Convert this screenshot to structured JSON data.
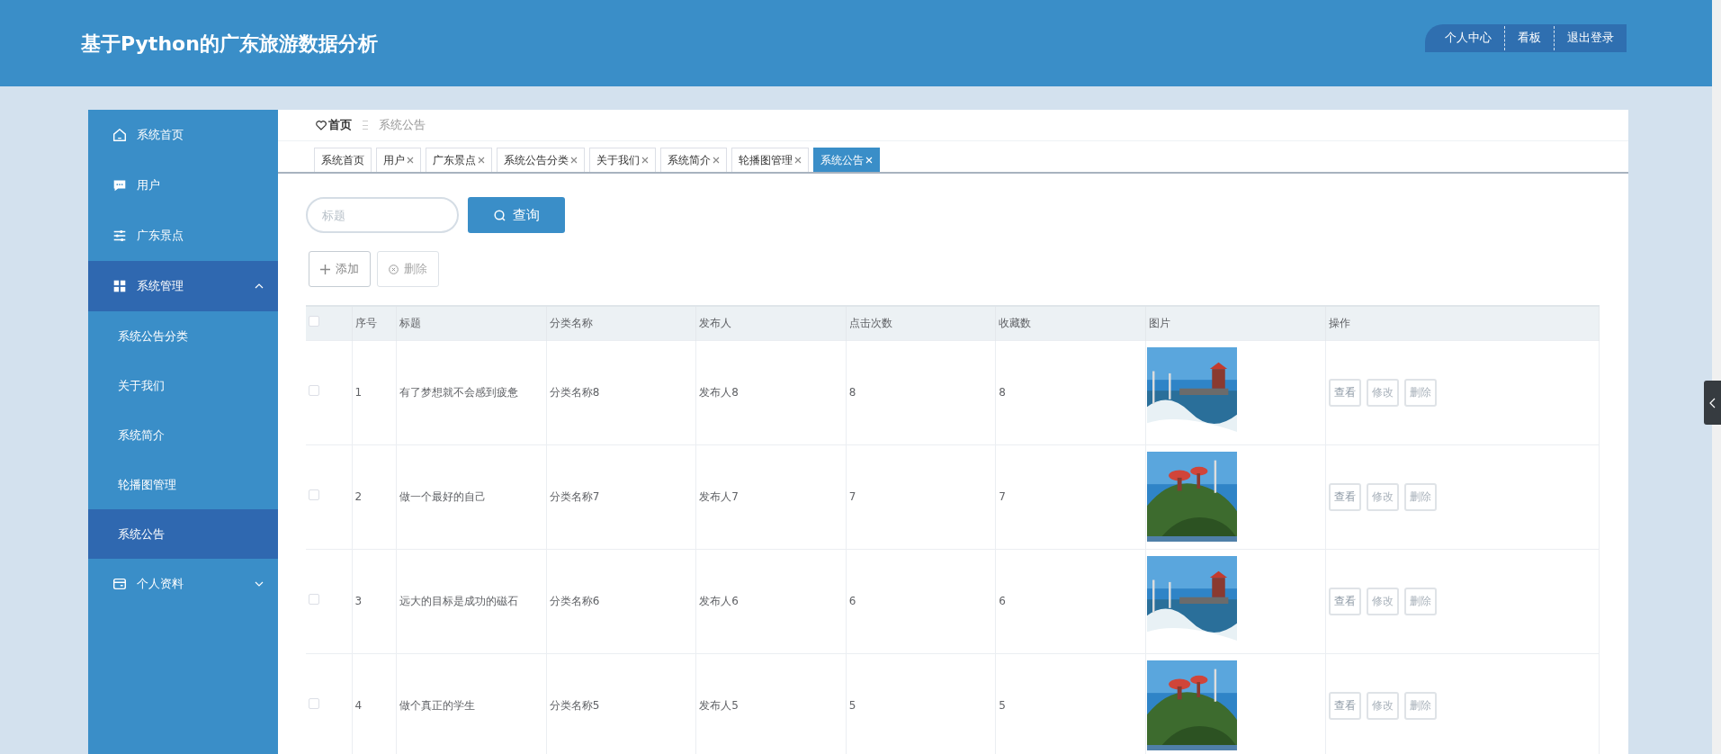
{
  "header": {
    "title": "基于Python的广东旅游数据分析",
    "menu": [
      "个人中心",
      "看板",
      "退出登录"
    ]
  },
  "sidebar": {
    "items": [
      {
        "label": "系统首页",
        "selected": false
      },
      {
        "label": "用户",
        "selected": false
      },
      {
        "label": "广东景点",
        "selected": false
      },
      {
        "label": "系统管理",
        "selected": false,
        "expanded": true,
        "children": [
          {
            "label": "系统公告分类",
            "selected": false
          },
          {
            "label": "关于我们",
            "selected": false
          },
          {
            "label": "系统简介",
            "selected": false
          },
          {
            "label": "轮播图管理",
            "selected": false
          },
          {
            "label": "系统公告",
            "selected": true
          }
        ]
      },
      {
        "label": "个人资料",
        "selected": false,
        "expanded": false
      }
    ]
  },
  "breadcrumb": [
    "首页",
    "系统公告"
  ],
  "tabs": [
    {
      "label": "系统首页",
      "closable": false,
      "selected": false
    },
    {
      "label": "用户",
      "closable": true,
      "selected": false
    },
    {
      "label": "广东景点",
      "closable": true,
      "selected": false
    },
    {
      "label": "系统公告分类",
      "closable": true,
      "selected": false
    },
    {
      "label": "关于我们",
      "closable": true,
      "selected": false
    },
    {
      "label": "系统简介",
      "closable": true,
      "selected": false
    },
    {
      "label": "轮播图管理",
      "closable": true,
      "selected": false
    },
    {
      "label": "系统公告",
      "closable": true,
      "selected": true
    }
  ],
  "search": {
    "placeholder": "标题",
    "button": "查询"
  },
  "actions": [
    "添加",
    "删除"
  ],
  "table": {
    "select_all": {
      "checked": false
    },
    "columns": [
      "序号",
      "标题",
      "分类名称",
      "发布人",
      "点击次数",
      "收藏数",
      "图片",
      "操作"
    ],
    "rows": [
      {
        "checked": false,
        "cells": [
          "1",
          "有了梦想就不会感到疲惫",
          "分类名称8",
          "发布人8",
          "8",
          "8"
        ],
        "picture": {
          "kind": "picture"
        },
        "buttons": [
          "查看",
          "修改",
          "删除"
        ]
      },
      {
        "checked": false,
        "cells": [
          "2",
          "做一个最好的自己",
          "分类名称7",
          "发布人7",
          "7",
          "7"
        ],
        "picture": {
          "kind": "picture"
        },
        "buttons": [
          "查看",
          "修改",
          "删除"
        ]
      },
      {
        "checked": false,
        "cells": [
          "3",
          "远大的目标是成功的磁石",
          "分类名称6",
          "发布人6",
          "6",
          "6"
        ],
        "picture": {
          "kind": "picture"
        },
        "buttons": [
          "查看",
          "修改",
          "删除"
        ]
      },
      {
        "checked": false,
        "cells": [
          "4",
          "做个真正的学生",
          "分类名称5",
          "发布人5",
          "5",
          "5"
        ],
        "picture": {
          "kind": "picture"
        },
        "buttons": [
          "查看",
          "修改",
          "删除"
        ]
      }
    ]
  }
}
